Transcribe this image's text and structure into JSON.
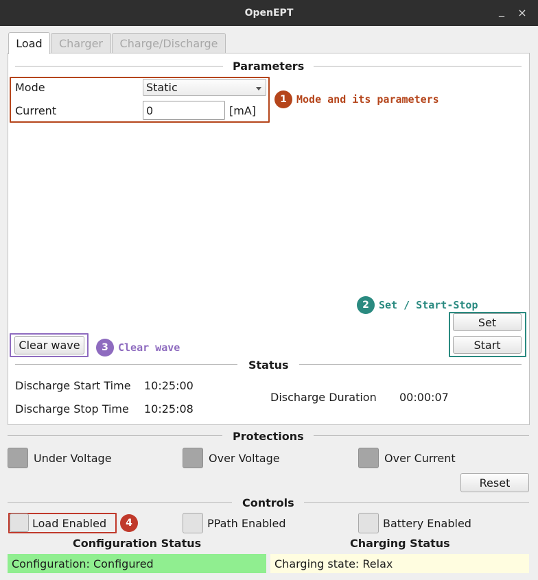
{
  "window": {
    "title": "OpenEPT",
    "minimize": "_",
    "close": "×"
  },
  "tabs": [
    {
      "label": "Load",
      "active": true
    },
    {
      "label": "Charger",
      "active": false
    },
    {
      "label": "Charge/Discharge",
      "active": false
    }
  ],
  "parameters": {
    "title": "Parameters",
    "mode_label": "Mode",
    "mode_value": "Static",
    "current_label": "Current",
    "current_value": "0",
    "current_unit": "[mA]"
  },
  "annotations": [
    {
      "number": "1",
      "text": "Mode and its parameters",
      "color": "#b5451b"
    },
    {
      "number": "2",
      "text": "Set / Start-Stop",
      "color": "#2a8a80"
    },
    {
      "number": "3",
      "text": "Clear wave",
      "color": "#8e6bbf"
    },
    {
      "number": "4",
      "text": "",
      "color": "#c0392b"
    }
  ],
  "buttons": {
    "set": "Set",
    "start": "Start",
    "clear_wave": "Clear wave",
    "reset": "Reset"
  },
  "status": {
    "title": "Status",
    "discharge_start_label": "Discharge Start Time",
    "discharge_start_value": "10:25:00",
    "discharge_stop_label": "Discharge Stop Time",
    "discharge_stop_value": "10:25:08",
    "discharge_duration_label": "Discharge Duration",
    "discharge_duration_value": "00:00:07"
  },
  "protections": {
    "title": "Protections",
    "items": [
      {
        "label": "Under Voltage"
      },
      {
        "label": "Over Voltage"
      },
      {
        "label": "Over Current"
      }
    ]
  },
  "controls": {
    "title": "Controls",
    "items": [
      {
        "label": "Load Enabled",
        "checked": false
      },
      {
        "label": "PPath Enabled",
        "checked": false
      },
      {
        "label": "Battery Enabled",
        "checked": false
      }
    ]
  },
  "configuration_status": {
    "title": "Configuration Status",
    "text": "Configuration: Configured",
    "color": "#90ee90"
  },
  "charging_status": {
    "title": "Charging Status",
    "text": "Charging state: Relax",
    "color": "#fffde0"
  }
}
